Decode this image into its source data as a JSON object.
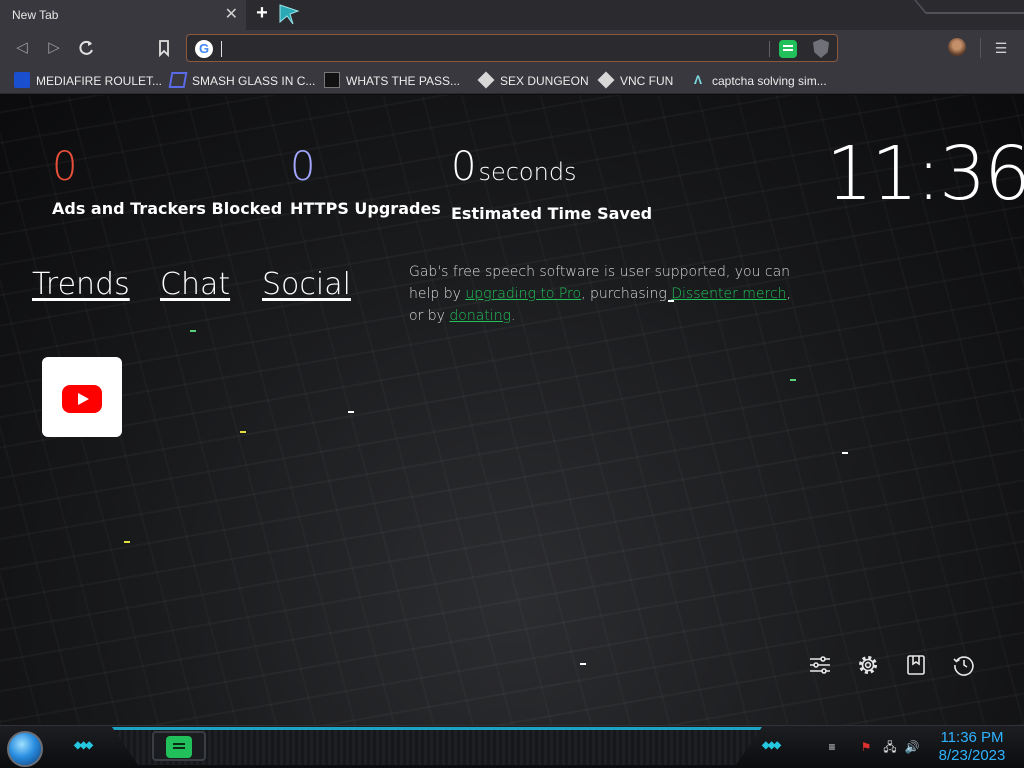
{
  "browser": {
    "tab": {
      "title": "New Tab",
      "close": "✕"
    },
    "new_tab": "+",
    "address_bar": {
      "value": "",
      "placeholder": ""
    },
    "bookmarks": [
      {
        "label": "MEDIAFIRE ROULET...",
        "icon": "mediafire-icon"
      },
      {
        "label": "SMASH GLASS IN C...",
        "icon": "smash-glass-icon"
      },
      {
        "label": "WHATS THE PASS...",
        "icon": "lock-icon"
      },
      {
        "label": "SEX DUNGEON",
        "icon": "cube-icon"
      },
      {
        "label": "VNC FUN",
        "icon": "cube-icon"
      },
      {
        "label": "captcha solving sim...",
        "icon": "caret-logo-icon"
      }
    ]
  },
  "stats": {
    "ads": {
      "value": "0",
      "label": "Ads and Trackers Blocked",
      "color": "#e8503a"
    },
    "https": {
      "value": "0",
      "label": "HTTPS Upgrades",
      "color": "#a3a6ff"
    },
    "time": {
      "value": "0",
      "unit": "seconds",
      "label": "Estimated Time Saved"
    }
  },
  "clock": "11:36",
  "nav_links": [
    "Trends",
    "Chat",
    "Social"
  ],
  "gab_message": {
    "part1": "Gab's free speech software is user supported, you can help by ",
    "link1": "upgrading to Pro",
    "part2": ", purchasing ",
    "link2": "Dissenter merch",
    "part3": ", or by ",
    "link3": "donating",
    "part4": "."
  },
  "top_sites": [
    {
      "name": "YouTube",
      "icon": "youtube-icon"
    }
  ],
  "page_actions": [
    "customize-icon",
    "settings-icon",
    "bookmarks-icon",
    "history-icon"
  ],
  "taskbar": {
    "time": "11:36 PM",
    "date": "8/23/2023"
  }
}
